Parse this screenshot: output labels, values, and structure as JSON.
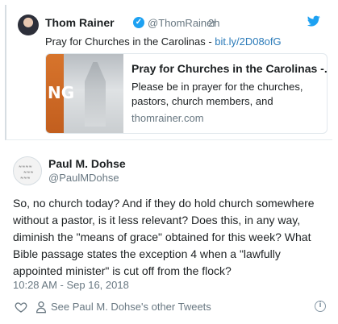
{
  "quoted_tweet": {
    "author_name": "Thom Rainer",
    "author_handle": "@ThomRainer",
    "separator": "·",
    "time": "2h",
    "text": "Pray for Churches in the Carolinas - ",
    "link": "bit.ly/2D08ofG",
    "card": {
      "image_text": "NG",
      "title": "Pray for Churches in the Carolinas -...",
      "description": "Please be in prayer for the churches, pastors, church members, and",
      "domain": "thomrainer.com"
    }
  },
  "tweet": {
    "author_name": "Paul M. Dohse",
    "author_handle": "@PaulMDohse",
    "text": "So, no church today? And if they do hold church somewhere without a pastor, is it less relevant? Does this, in any way, diminish the \"means of grace\" obtained for this week? What Bible passage states the exception 4 when a \"lawfully appointed minister\" is cut off from the flock?",
    "timestamp": "10:28 AM - Sep 16, 2018"
  },
  "actions": {
    "other_tweets_label": "See Paul M. Dohse's other Tweets"
  },
  "colors": {
    "link": "#2b7bb9",
    "muted": "#697882",
    "twitter_blue": "#1da1f2"
  }
}
